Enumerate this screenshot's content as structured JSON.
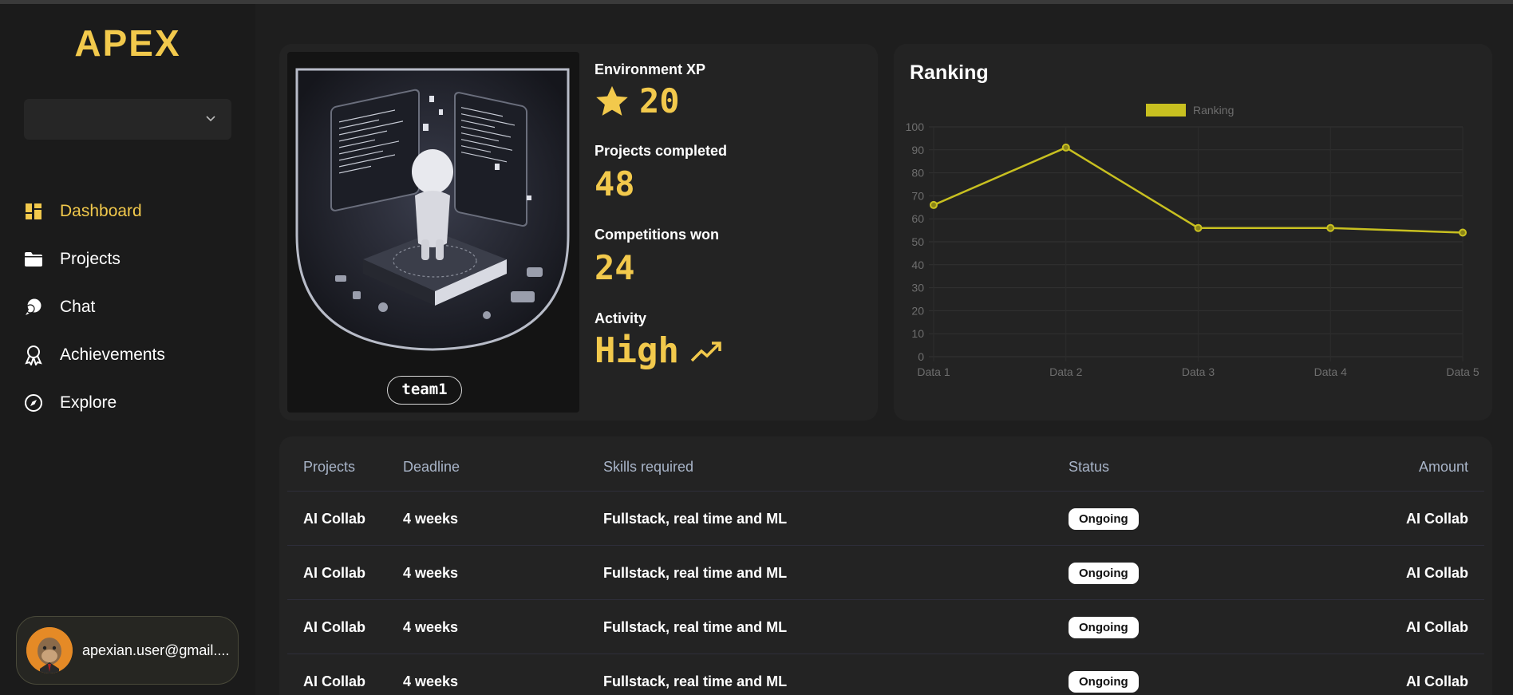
{
  "app": {
    "logo": "APEX"
  },
  "sidebar": {
    "select": {
      "value": ""
    },
    "items": [
      {
        "label": "Dashboard",
        "icon": "dashboard-icon",
        "active": true
      },
      {
        "label": "Projects",
        "icon": "folder-icon"
      },
      {
        "label": "Chat",
        "icon": "chat-icon"
      },
      {
        "label": "Achievements",
        "icon": "award-icon"
      },
      {
        "label": "Explore",
        "icon": "compass-icon"
      }
    ],
    "user": {
      "email": "apexian.user@gmail...."
    }
  },
  "profile": {
    "team_name": "team1",
    "stats": {
      "xp_label": "Environment XP",
      "xp_value": "20",
      "projects_label": "Projects completed",
      "projects_value": "48",
      "competitions_label": "Competitions won",
      "competitions_value": "24",
      "activity_label": "Activity",
      "activity_value": "High"
    }
  },
  "ranking": {
    "title": "Ranking",
    "legend_label": "Ranking"
  },
  "chart_data": {
    "type": "line",
    "categories": [
      "Data 1",
      "Data 2",
      "Data 3",
      "Data 4",
      "Data 5"
    ],
    "series": [
      {
        "name": "Ranking",
        "values": [
          66,
          91,
          56,
          56,
          54
        ]
      }
    ],
    "ylim": [
      0,
      100
    ],
    "yticks": [
      0,
      10,
      20,
      30,
      40,
      50,
      60,
      70,
      80,
      90,
      100
    ],
    "legend_position": "top-center",
    "grid": true,
    "color": "#c8c020"
  },
  "table": {
    "headers": {
      "projects": "Projects",
      "deadline": "Deadline",
      "skills": "Skills required",
      "status": "Status",
      "amount": "Amount"
    },
    "rows": [
      {
        "project": "AI Collab",
        "deadline": "4 weeks",
        "skills": "Fullstack, real time and ML",
        "status": "Ongoing",
        "amount": "AI Collab"
      },
      {
        "project": "AI Collab",
        "deadline": "4 weeks",
        "skills": "Fullstack, real time and ML",
        "status": "Ongoing",
        "amount": "AI Collab"
      },
      {
        "project": "AI Collab",
        "deadline": "4 weeks",
        "skills": "Fullstack, real time and ML",
        "status": "Ongoing",
        "amount": "AI Collab"
      },
      {
        "project": "AI Collab",
        "deadline": "4 weeks",
        "skills": "Fullstack, real time and ML",
        "status": "Ongoing",
        "amount": "AI Collab"
      }
    ]
  },
  "colors": {
    "accent": "#f2c94c",
    "panel": "#232323",
    "background": "#1e1e1e"
  }
}
